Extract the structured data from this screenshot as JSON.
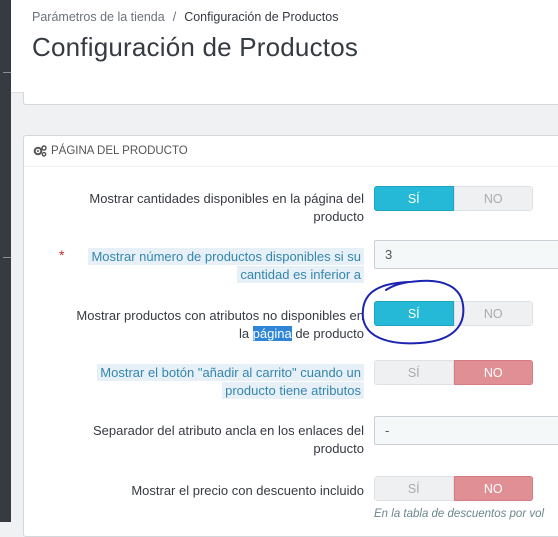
{
  "breadcrumb": {
    "parent": "Parámetros de la tienda",
    "separator": "/",
    "current": "Configuración de Productos"
  },
  "page_title": "Configuración de Productos",
  "panel": {
    "icon": "gears-icon",
    "title": "PÁGINA DEL PRODUCTO"
  },
  "settings": [
    {
      "label_1": "Mostrar cantidades disponibles en la página del",
      "label_2": "producto",
      "control": "switch",
      "yes": "SÍ",
      "no": "NO",
      "value": "yes"
    },
    {
      "required": "*",
      "label_1": "Mostrar número de productos disponibles si su",
      "label_2": "cantidad es inferior a",
      "control": "text",
      "value": "3"
    },
    {
      "label_1": "Mostrar productos con atributos no disponibles en",
      "label_2a": "la ",
      "label_2_sel": "página",
      "label_2b": " de producto",
      "control": "switch",
      "yes": "SÍ",
      "no": "NO",
      "value": "yes"
    },
    {
      "label_1": "Mostrar el botón \"añadir al carrito\" cuando un",
      "label_2": "producto tiene atributos",
      "control": "switch",
      "yes": "SÍ",
      "no": "NO",
      "value": "no"
    },
    {
      "label_1": "Separador del atributo ancla en los enlaces del",
      "label_2": "producto",
      "control": "text",
      "value": "-"
    },
    {
      "label_1": "Mostrar el precio con descuento incluido",
      "control": "switch",
      "yes": "SÍ",
      "no": "NO",
      "value": "no",
      "help": "En la tabla de descuentos por vol"
    }
  ],
  "colors": {
    "switch_on_yes": "#25b9d7",
    "switch_on_no": "#e08f95",
    "annotation_ink": "#1c24b0"
  }
}
